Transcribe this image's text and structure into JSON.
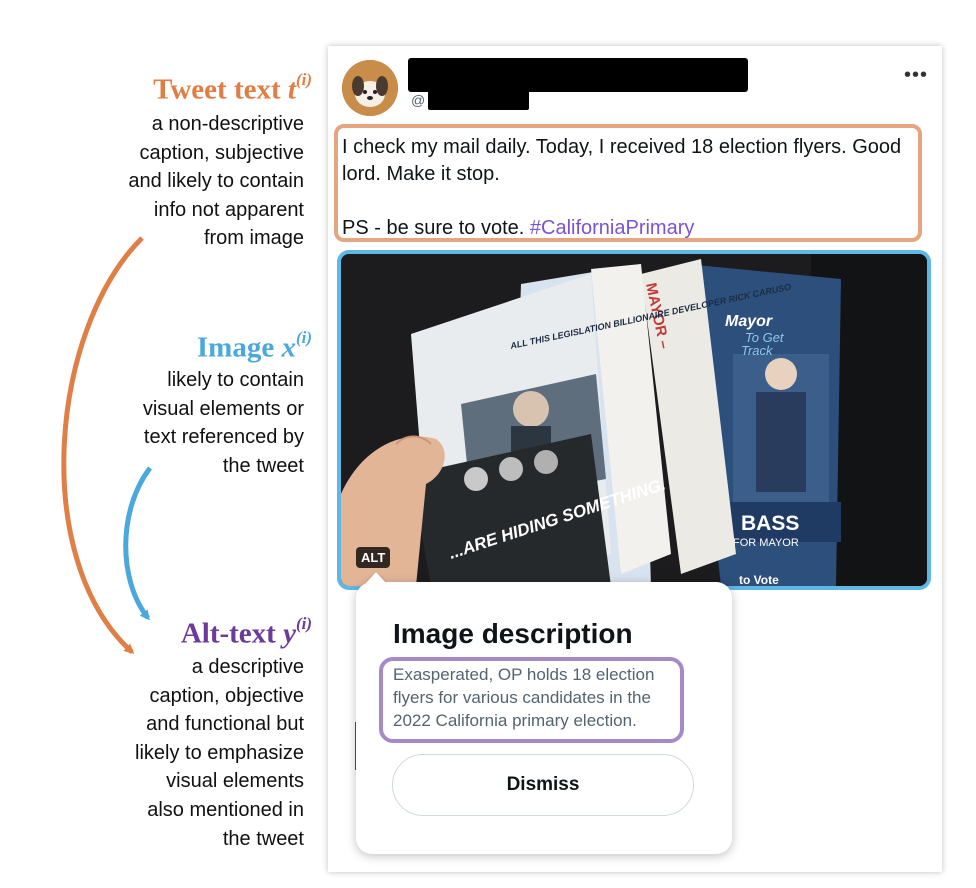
{
  "annotations": {
    "tweet_text": {
      "label": "Tweet text",
      "var": "t",
      "sup": "(i)",
      "desc": [
        "a non-descriptive",
        "caption, subjective",
        "and likely to contain",
        "info not apparent",
        "from image"
      ],
      "color": "#e07f45"
    },
    "image": {
      "label": "Image",
      "var": "x",
      "sup": "(i)",
      "desc": [
        "likely to contain",
        "visual elements or",
        "text referenced by",
        "the tweet"
      ],
      "color": "#4aa8dd"
    },
    "alt_text": {
      "label": "Alt-text",
      "var": "y",
      "sup": "(i)",
      "desc": [
        "a descriptive",
        "caption, objective",
        "and functional but",
        "likely to emphasize",
        "visual elements",
        "also mentioned in",
        "the tweet"
      ],
      "color": "#6c3a9a"
    }
  },
  "tweet": {
    "handle_prefix": "@",
    "more_icon": "more-horizontal-icon",
    "text_lines": [
      "I check my mail daily. Today, I received 18 election flyers.  Good",
      "lord. Make it stop."
    ],
    "ps_text": "PS - be sure to vote. ",
    "hashtag": "#CaliforniaPrimary",
    "alt_badge": "ALT",
    "flyer_texts": {
      "hiding": "...ARE HIDING SOMETHING.",
      "billionaire": "ALL THIS LEGISLATION BILLIONAIRE DEVELOPER RICK CARUSO",
      "mayor_top": "MAYOR –",
      "mayor_right": "Mayor",
      "to_get": "To Get",
      "track": "Track",
      "bass": "BASS",
      "for_mayor": "FOR MAYOR",
      "to_vote": "to Vote"
    }
  },
  "popover": {
    "title": "Image description",
    "description_lines": [
      "Exasperated, OP holds 18 election",
      "flyers for various candidates in the",
      "2022 California primary election."
    ],
    "dismiss_label": "Dismiss"
  }
}
